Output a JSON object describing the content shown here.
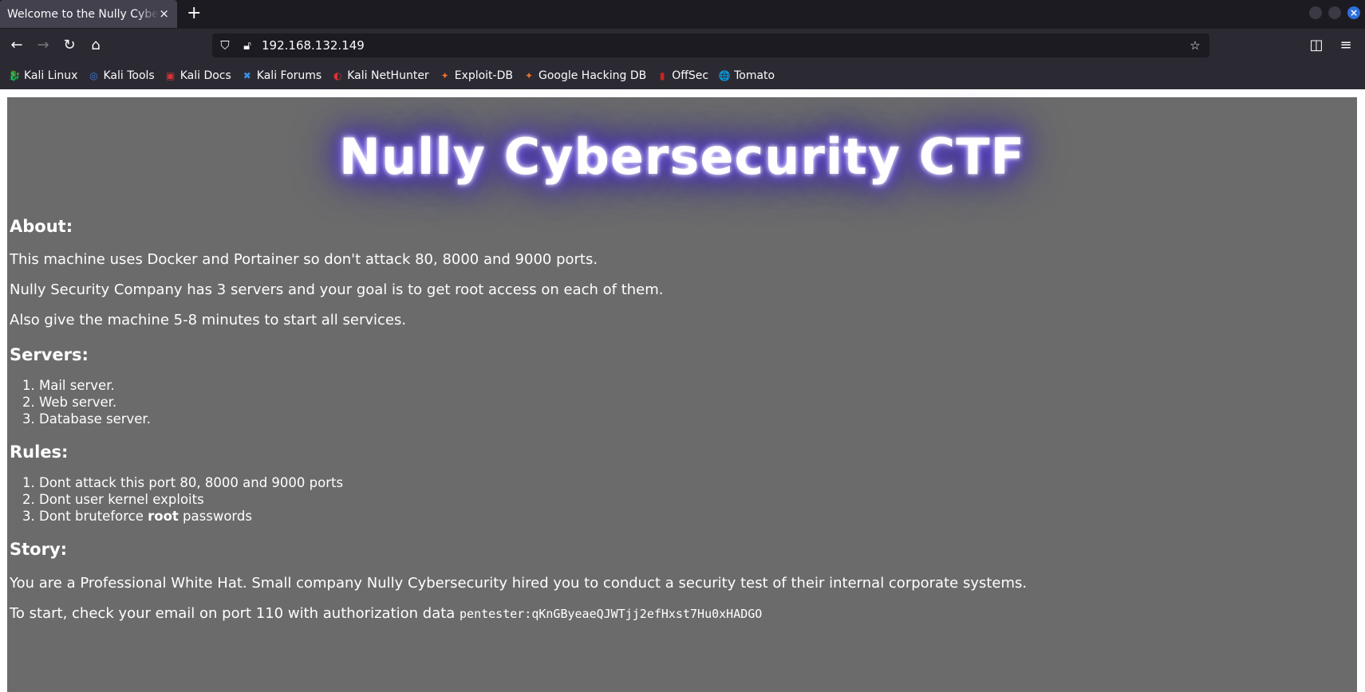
{
  "browser": {
    "tab_title": "Welcome to the Nully Cybersecurity CTF",
    "tab_close": "×",
    "new_tab": "+",
    "url": "192.168.132.149",
    "bookmarks": [
      {
        "label": "Kali Linux",
        "icon": "kali-dragon-icon",
        "glyph": "🐉",
        "color": "#d0d0d0"
      },
      {
        "label": "Kali Tools",
        "icon": "kali-tools-icon",
        "glyph": "◎",
        "color": "#3b7be8"
      },
      {
        "label": "Kali Docs",
        "icon": "kali-docs-icon",
        "glyph": "▣",
        "color": "#e03030"
      },
      {
        "label": "Kali Forums",
        "icon": "kali-forums-icon",
        "glyph": "✖",
        "color": "#3b8fe8"
      },
      {
        "label": "Kali NetHunter",
        "icon": "nethunter-icon",
        "glyph": "◐",
        "color": "#e03030"
      },
      {
        "label": "Exploit-DB",
        "icon": "exploit-db-icon",
        "glyph": "✦",
        "color": "#e8702a"
      },
      {
        "label": "Google Hacking DB",
        "icon": "ghdb-icon",
        "glyph": "✦",
        "color": "#e8702a"
      },
      {
        "label": "OffSec",
        "icon": "offsec-icon",
        "glyph": "▮",
        "color": "#d02020"
      },
      {
        "label": "Tomato",
        "icon": "globe-icon",
        "glyph": "🌐",
        "color": "#fbfbfe"
      }
    ]
  },
  "page": {
    "hero": "Nully Cybersecurity CTF",
    "about_heading": "About:",
    "about_p1": "This machine uses Docker and Portainer so don't attack 80, 8000 and 9000 ports.",
    "about_p2": "Nully Security Company has 3 servers and your goal is to get root access on each of them.",
    "about_p3": "Also give the machine 5-8 minutes to start all services.",
    "servers_heading": "Servers:",
    "servers": [
      "Mail server.",
      "Web server.",
      "Database server."
    ],
    "rules_heading": "Rules:",
    "rule1": "Dont attack this port 80, 8000 and 9000 ports",
    "rule2": "Dont user kernel exploits",
    "rule3_pre": "Dont bruteforce ",
    "rule3_bold": "root",
    "rule3_post": " passwords",
    "story_heading": "Story:",
    "story_p1": "You are a Professional White Hat. Small company Nully Cybersecurity hired you to conduct a security test of their internal corporate systems.",
    "story_p2": "To start, check your email on port 110 with authorization data ",
    "credentials": "pentester:qKnGByeaeQJWTjj2efHxst7Hu0xHADGO"
  }
}
